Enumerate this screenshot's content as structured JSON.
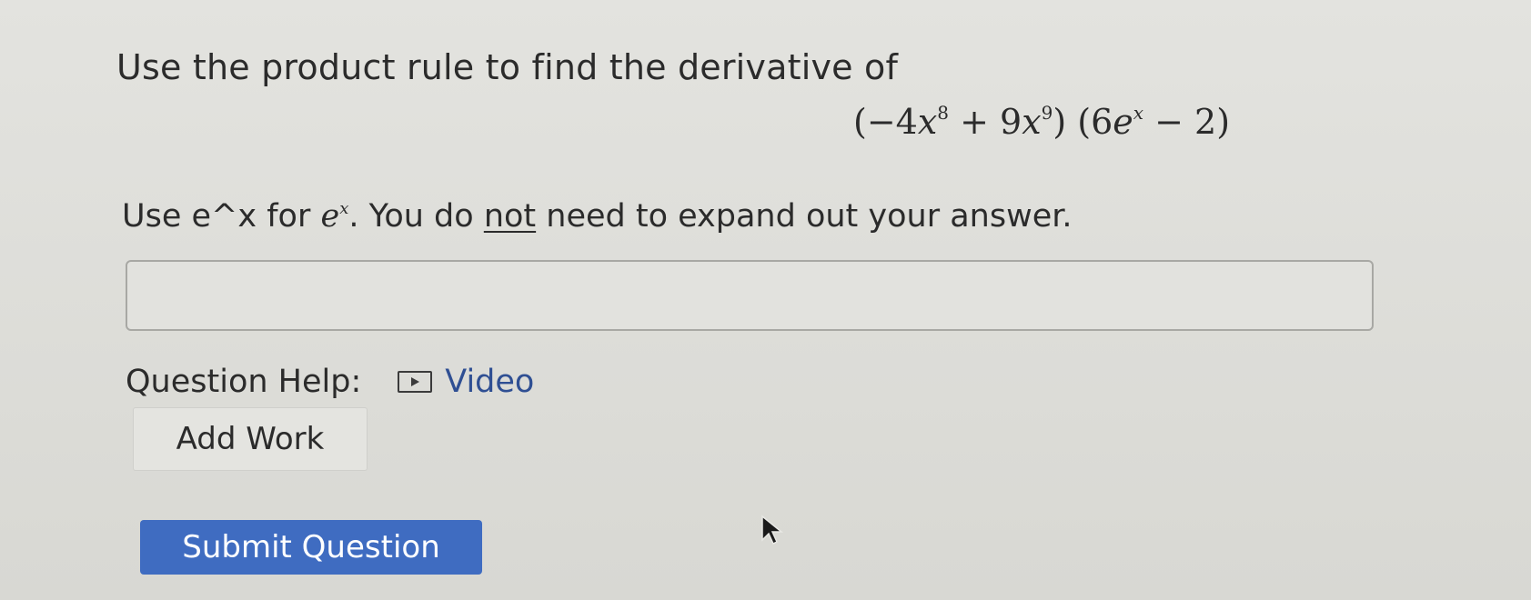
{
  "question": {
    "prompt": "Use the product rule to find the derivative of",
    "formula": {
      "open": "(−4",
      "x1": "x",
      "exp1": "8",
      "mid": " + 9",
      "x2": "x",
      "exp2": "9",
      "mid2": ") (6",
      "e": "e",
      "exp3": "x",
      "close": " − 2)"
    }
  },
  "instructions": {
    "part1": "Use e^x for ",
    "e": "e",
    "exp": "x",
    "part2": ". You do ",
    "underlined": "not",
    "part3": " need to expand out your answer."
  },
  "answer": {
    "value": "",
    "placeholder": ""
  },
  "help": {
    "label": "Question Help:",
    "video_label": "Video"
  },
  "buttons": {
    "add_work": "Add Work",
    "submit": "Submit Question"
  }
}
